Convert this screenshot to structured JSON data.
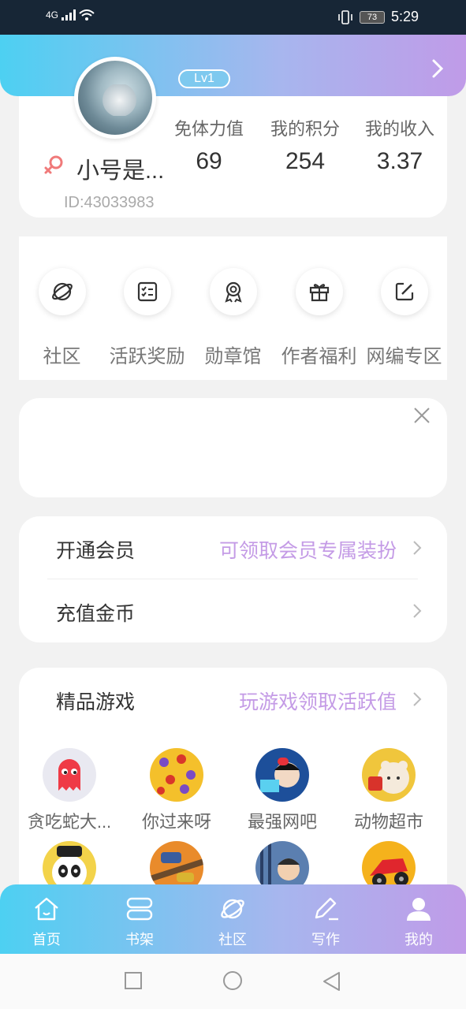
{
  "status_bar": {
    "signal": "4G",
    "battery": "73",
    "time": "5:29"
  },
  "profile": {
    "level": "Lv1",
    "nickname": "小号是...",
    "user_id": "ID:43033983",
    "stats": [
      {
        "label": "免体力值",
        "value": "69"
      },
      {
        "label": "我的积分",
        "value": "254"
      },
      {
        "label": "我的收入",
        "value": "3.37"
      }
    ]
  },
  "entries": [
    {
      "label": "社区",
      "icon": "planet-icon"
    },
    {
      "label": "活跃奖励",
      "icon": "checklist-icon"
    },
    {
      "label": "勋章馆",
      "icon": "medal-icon"
    },
    {
      "label": "作者福利",
      "icon": "gift-icon"
    },
    {
      "label": "网编专区",
      "icon": "edit-icon"
    }
  ],
  "menu": {
    "vip": {
      "label": "开通会员",
      "hint": "可领取会员专属装扮"
    },
    "recharge": {
      "label": "充值金币"
    }
  },
  "games": {
    "title": "精品游戏",
    "hint": "玩游戏领取活跃值",
    "items": [
      {
        "name": "贪吃蛇大...",
        "color": "#e9e9f1"
      },
      {
        "name": "你过来呀",
        "color": "#f4c02b"
      },
      {
        "name": "最强网吧",
        "color": "#1d4f9a"
      },
      {
        "name": "动物超市",
        "color": "#f0c63c"
      },
      {
        "name": "",
        "color": "#f3d34a"
      },
      {
        "name": "",
        "color": "#e98b2b"
      },
      {
        "name": "",
        "color": "#5b7fb0"
      },
      {
        "name": "",
        "color": "#f5b21c"
      }
    ]
  },
  "tabs": [
    {
      "label": "首页",
      "icon": "home-icon"
    },
    {
      "label": "书架",
      "icon": "bookshelf-icon"
    },
    {
      "label": "社区",
      "icon": "planet-icon"
    },
    {
      "label": "写作",
      "icon": "pen-icon"
    },
    {
      "label": "我的",
      "icon": "user-icon"
    }
  ],
  "colors": {
    "accent_from": "#4dd0f2",
    "accent_to": "#c09be8",
    "hint": "#c49be6"
  }
}
